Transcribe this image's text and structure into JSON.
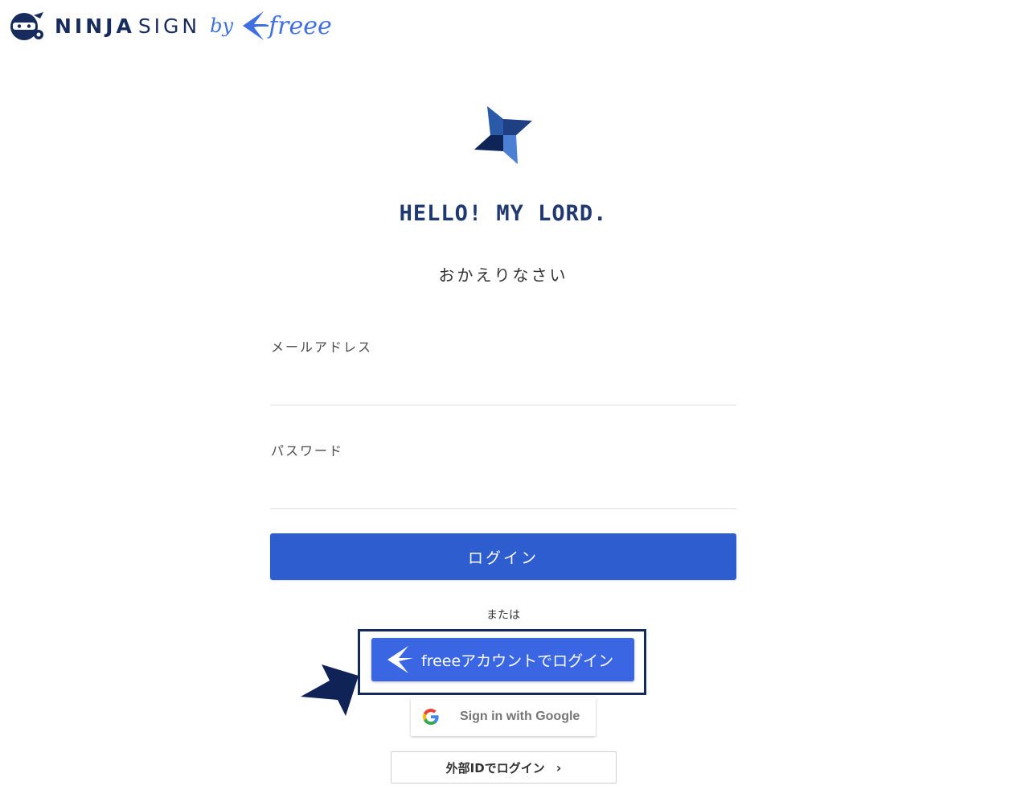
{
  "brand": {
    "ninja": "NINJA",
    "sign": "SIGN",
    "by": "by",
    "freee": "freee",
    "navy": "#172c5d",
    "blue": "#3f6fe0",
    "mascot_icon": "ninja-mascot-icon",
    "freee_icon": "freee-bird-icon"
  },
  "hero": {
    "logo_icon": "shuriken-icon",
    "greeting": "HELLO! MY LORD.",
    "welcome": "おかえりなさい"
  },
  "form": {
    "email_label": "メールアドレス",
    "email_value": "",
    "password_label": "パスワード",
    "password_value": "",
    "login_label": "ログイン",
    "login_color": "#2d5dcf"
  },
  "alternatives": {
    "or_label": "または",
    "freee_login_label": "freeeアカウントでログイン",
    "freee_color": "#3a66e3",
    "google_label": "Sign in with Google",
    "external_id_label": "外部IDでログイン",
    "external_chevron": "›"
  },
  "annotation": {
    "highlight_color": "#142a5c",
    "arrow_icon": "pointer-arrow-icon"
  }
}
